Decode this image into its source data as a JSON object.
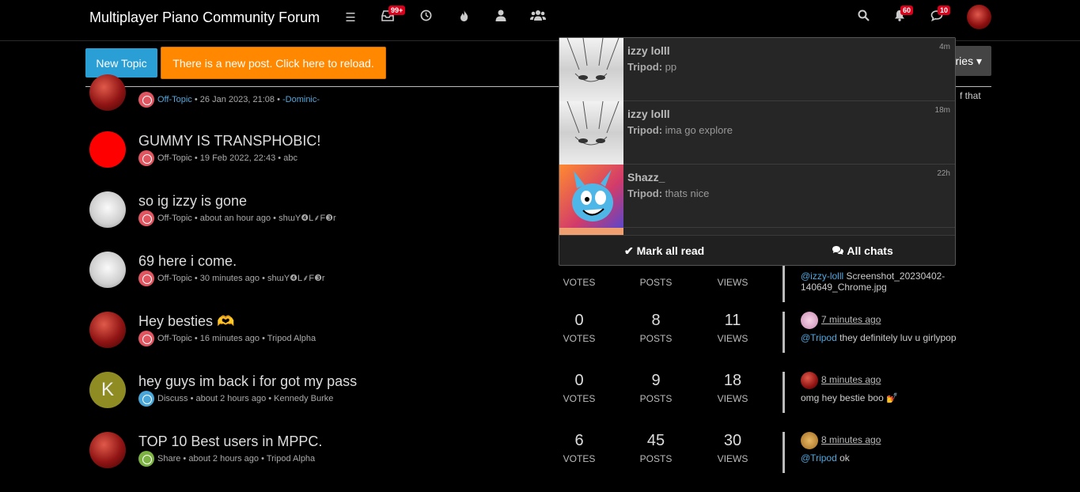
{
  "header": {
    "title": "Multiplayer Piano Community Forum",
    "badges": {
      "unread": "99+",
      "notifications": "60",
      "chats": "10"
    },
    "icons": [
      "list-icon",
      "inbox-icon",
      "clock-icon",
      "fire-icon",
      "user-icon",
      "users-icon",
      "search-icon",
      "bell-icon",
      "comments-icon"
    ]
  },
  "toolbar": {
    "new_topic": "New Topic",
    "reload_notice": "There is a new post. Click here to reload.",
    "categories_label": "ries ▾"
  },
  "topics": [
    {
      "title": "",
      "category": "Off-Topic",
      "time": "26 Jan 2023, 21:08",
      "author": "-Dominic-",
      "teaser_text": "f that"
    },
    {
      "title": "GUMMY IS TRANSPHOBIC!",
      "category": "Off-Topic",
      "time": "19 Feb 2022, 22:43",
      "author": "abc"
    },
    {
      "title": "so ig izzy is gone",
      "category": "Off-Topic",
      "time": "about an hour ago",
      "author": "shɯY❹L⸙F❸r"
    },
    {
      "title": "69 here i come.",
      "category": "Off-Topic",
      "time": "30 minutes ago",
      "author": "shɯY❹L⸙F❸r",
      "votes_label": "VOTES",
      "posts_label": "POSTS",
      "views_label": "VIEWS",
      "teaser_user": "@izzy-lolll",
      "teaser_text": "Screenshot_20230402-140649_Chrome.jpg"
    },
    {
      "title": "Hey besties 🫶",
      "category": "Off-Topic",
      "time": "16 minutes ago",
      "author": "Tripod Alpha",
      "votes": "0",
      "posts": "8",
      "views": "11",
      "votes_label": "VOTES",
      "posts_label": "POSTS",
      "views_label": "VIEWS",
      "teaser_time": "7 minutes ago",
      "teaser_user": "@Tripod",
      "teaser_text": "they definitely luv u girlypop"
    },
    {
      "title": "hey guys im back i for got my pass",
      "category": "Discuss",
      "time": "about 2 hours ago",
      "author": "Kennedy Burke",
      "avatar_letter": "K",
      "votes": "0",
      "posts": "9",
      "views": "18",
      "votes_label": "VOTES",
      "posts_label": "POSTS",
      "views_label": "VIEWS",
      "teaser_time": "8 minutes ago",
      "teaser_text": "omg hey bestie boo 💅"
    },
    {
      "title": "TOP 10 Best users in MPPC.",
      "category": "Share",
      "time": "about 2 hours ago",
      "author": "Tripod Alpha",
      "votes": "6",
      "posts": "45",
      "views": "30",
      "votes_label": "VOTES",
      "posts_label": "POSTS",
      "views_label": "VIEWS",
      "teaser_time": "8 minutes ago",
      "teaser_user": "@Tripod",
      "teaser_text": "ok"
    }
  ],
  "separator": "•",
  "chats": {
    "items": [
      {
        "name": "izzy lolll",
        "sender": "Tripod:",
        "message": "pp",
        "time": "4m"
      },
      {
        "name": "izzy lolll",
        "sender": "Tripod:",
        "message": "ima go explore",
        "time": "18m"
      },
      {
        "name": "Shazz_",
        "sender": "Tripod:",
        "message": "thats nice",
        "time": "22h"
      }
    ],
    "mark_all_read": "Mark all read",
    "all_chats": "All chats"
  }
}
